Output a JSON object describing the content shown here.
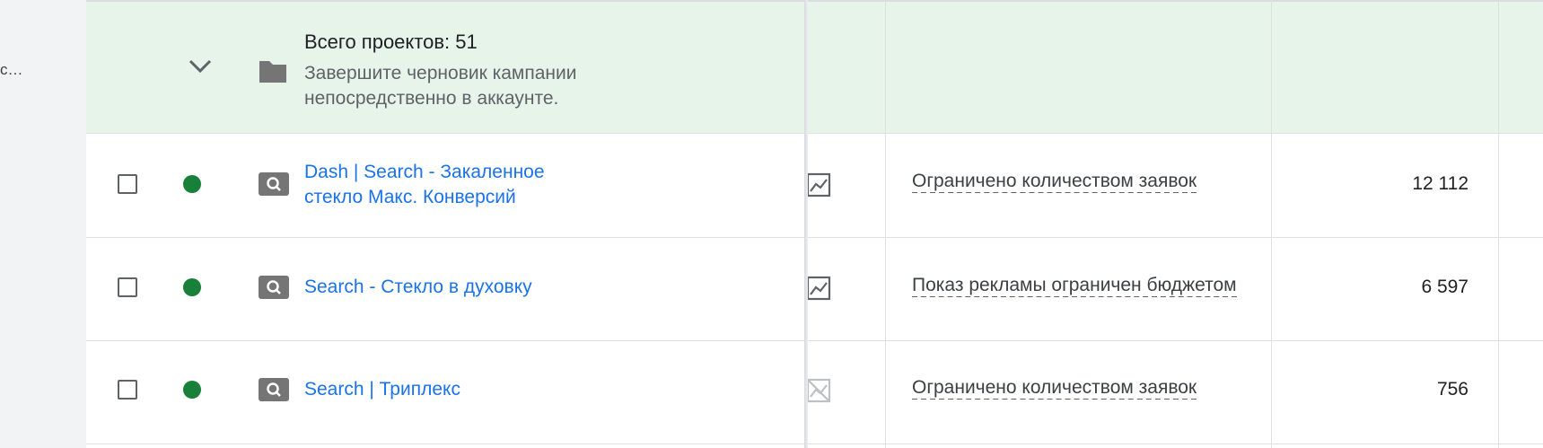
{
  "sidebar": {
    "truncated_label": "с…"
  },
  "summary": {
    "title": "Всего проектов: 51",
    "subtitle": "Завершите черновик кампании непосредственно в аккаунте."
  },
  "rows": [
    {
      "campaign_line1": "Dash | Search - Закаленное",
      "campaign_line2": "стекло Макс. Конверсий",
      "status": "Ограничено количеством заявок",
      "budget": "12 112",
      "chart_icon": "chart-icon"
    },
    {
      "campaign_line1": "Search - Стекло в духовку",
      "campaign_line2": "",
      "status": "Показ рекламы ограничен бюджетом",
      "budget": "6 597",
      "chart_icon": "chart-icon"
    },
    {
      "campaign_line1": "Search | Триплекс",
      "campaign_line2": "",
      "status": "Ограничено количеством заявок",
      "budget": "756",
      "chart_icon": "chart-off-icon"
    }
  ],
  "colors": {
    "summary_bg": "#e6f4ea",
    "link": "#1a73e8",
    "status_enabled": "#188038"
  }
}
